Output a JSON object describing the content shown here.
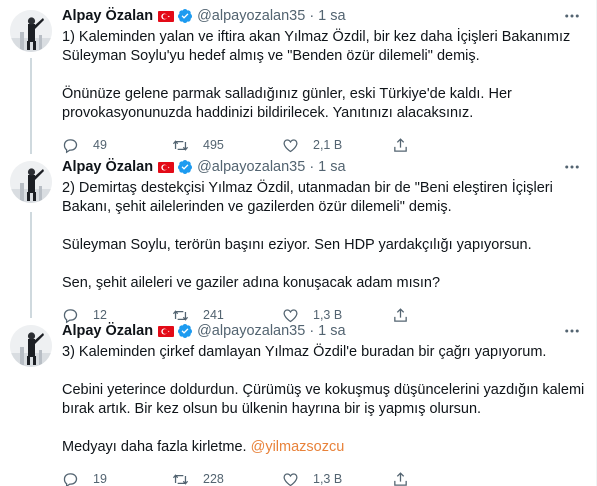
{
  "tweets": [
    {
      "name": "Alpay Özalan",
      "handle": "@alpayozalan35",
      "separator": "·",
      "time": "1 sa",
      "paragraphs": [
        "1) Kaleminden yalan ve iftira akan Yılmaz Özdil, bir kez daha İçişleri Bakanımız Süleyman Soylu'yu hedef almış ve \"Benden özür dilemeli\" demiş.",
        "Önünüze gelene parmak salladığınız günler, eski Türkiye'de kaldı. Her provokasyonunuzda haddinizi bildirilecek. Yanıtınızı alacaksınız."
      ],
      "replies": "49",
      "retweets": "495",
      "likes": "2,1 B"
    },
    {
      "name": "Alpay Özalan",
      "handle": "@alpayozalan35",
      "separator": "·",
      "time": "1 sa",
      "paragraphs": [
        "2) Demirtaş destekçisi Yılmaz Özdil, utanmadan bir de \"Beni eleştiren İçişleri Bakanı, şehit ailelerinden ve gazilerden özür dilemeli\" demiş.",
        "Süleyman Soylu, terörün başını eziyor. Sen HDP yardakçılığı yapıyorsun.",
        "Sen, şehit aileleri ve gaziler adına konuşacak adam mısın?"
      ],
      "replies": "12",
      "retweets": "241",
      "likes": "1,3 B"
    },
    {
      "name": "Alpay Özalan",
      "handle": "@alpayozalan35",
      "separator": "·",
      "time": "1 sa",
      "paragraphs": [
        "3) Kaleminden çirkef damlayan Yılmaz Özdil'e buradan bir çağrı yapıyorum.",
        "Cebini yeterince doldurdun. Çürümüş ve kokuşmuş düşüncelerini yazdığın kalemi bırak artık. Bir kez olsun bu ülkenin hayrına bir iş yapmış olursun."
      ],
      "final_text": "Medyayı daha fazla kirletme.",
      "mention": "@yilmazsozcu",
      "replies": "19",
      "retweets": "228",
      "likes": "1,3 B"
    }
  ],
  "icons": {
    "verified": "verified-badge-icon",
    "flag": "turkey-flag-icon",
    "more": "more-options-icon",
    "reply": "reply-icon",
    "retweet": "retweet-icon",
    "like": "like-icon",
    "share": "share-icon"
  },
  "colors": {
    "text": "#0f1419",
    "secondary": "#536471",
    "verified": "#1d9bf0",
    "mention": "#e8823a",
    "flag": "#e30a17",
    "divider": "#eff3f4"
  }
}
